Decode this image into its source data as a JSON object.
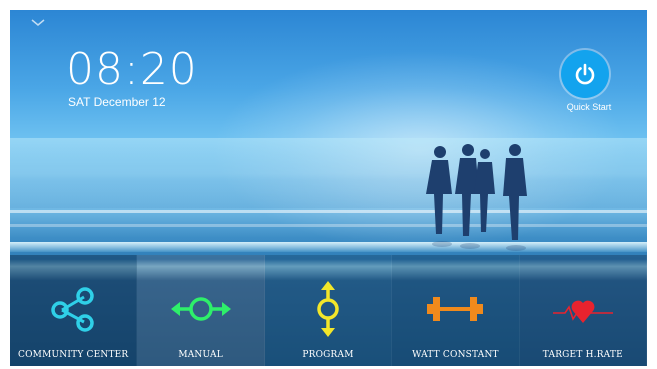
{
  "clock": {
    "time": "08:20",
    "date": "SAT December 12"
  },
  "quick_start": {
    "label": "Quick Start",
    "icon": "power-icon"
  },
  "menu": {
    "items": [
      {
        "label": "COMMUNITY CENTER",
        "icon": "share-icon",
        "color": "#2fd0e8"
      },
      {
        "label": "MANUAL",
        "icon": "manual-arrows-icon",
        "color": "#2ef06a"
      },
      {
        "label": "PROGRAM",
        "icon": "program-arrows-icon",
        "color": "#f2e62a"
      },
      {
        "label": "WATT CONSTANT",
        "icon": "dumbbell-icon",
        "color": "#f08a1c"
      },
      {
        "label": "TARGET H.RATE",
        "icon": "heart-rate-icon",
        "color": "#e8232e"
      }
    ]
  },
  "colors": {
    "accent": "#13a3ee"
  }
}
